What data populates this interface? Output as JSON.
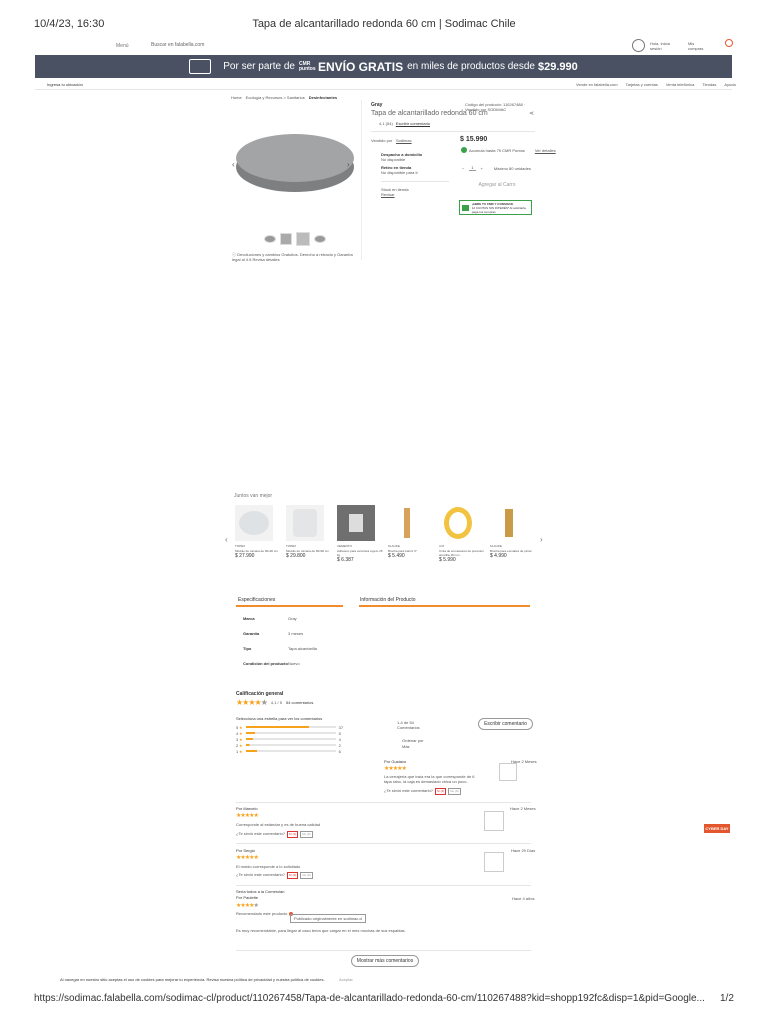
{
  "print_header": {
    "datetime": "10/4/23, 16:30",
    "title": "Tapa de alcantarillado redonda 60 cm | Sodimac Chile"
  },
  "print_footer": {
    "url": "https://sodimac.falabella.com/sodimac-cl/product/110267458/Tapa-de-alcantarillado-redonda-60-cm/110267488?kid=shopp192fc&disp=1&pid=Google...",
    "page": "1/2"
  },
  "top_nav": {
    "menu": "Menú",
    "search_placeholder": "Buscar en falabella.com",
    "account": "Hola, Inicia sesión",
    "orders": "Mis compras"
  },
  "banner": {
    "prefix": "Por ser parte de",
    "cmr": "CMR puntos",
    "highlight": "ENVÍO GRATIS",
    "suffix": "en miles de productos desde",
    "price": "$29.990"
  },
  "subnav": {
    "location": "Ingresa tu ubicación",
    "links": [
      "Vende en falabella.com",
      "Tarjetas y cuentas",
      "Venta telefónica",
      "Tiendas",
      "Ayuda"
    ]
  },
  "breadcrumb": [
    "Home",
    "Ecología y Recursos > Sanitarios",
    "Desinfectantes"
  ],
  "product": {
    "brand": "Gray",
    "name": "Tapa de alcantarillado redonda 60 cm",
    "code": "Código del producto: 110267488 · Vendido por SODIMAC",
    "rating_text": "4,1 (54)",
    "write_review": "Escribir comentario",
    "seller_label": "Vendido por",
    "seller": "Sodimac",
    "price": "$ 15.990",
    "cmr_text": "Acumula hasta 79 CMR Puntos",
    "cmr_link": "Ver detalles",
    "quantity": "1",
    "max_units": "Máximo 80 unidades",
    "add_cart": "Agregar al Carro",
    "delivery_title": "Despacho a domicilio",
    "delivery_status": "No disponible",
    "pickup_title": "Retiro en tienda",
    "pickup_status": "No disponible para ti",
    "stock_title": "Stock en tienda",
    "stock_link": "Revisar",
    "cmr_promo_title": "¡ABRE TU CMR Y CONSIGUE",
    "cmr_promo_sub": "12 CUOTAS SIN INTERÉS* Al solicitarla, paga tus compras",
    "note": "Devoluciones y cambios Gratuitos. Derecho a retracto y Garantía legal al 4.5 Revisa detalles"
  },
  "recommendations": {
    "title": "Juntos van mejor",
    "items": [
      {
        "brand": "TOPEX",
        "name": "Módulo de cámara de 60x30 cm",
        "price": "$ 27.990"
      },
      {
        "brand": "TOPEX",
        "name": "Módulo de cámara de 60x60 cm",
        "price": "$ 29.800"
      },
      {
        "brand": "CEMENTO",
        "name": "Adhesivo para cerámica Ligero 25 kg",
        "price": "$ 6.387"
      },
      {
        "brand": "KLAUKE",
        "name": "Brocha para barniz 3\"",
        "price": "$ 5.490"
      },
      {
        "brand": "3 M",
        "name": "Cinta de enmascarar de precisión amarilla 18 mm",
        "price": "$ 5.990"
      },
      {
        "brand": "KLAUKE",
        "name": "Brocha para esmaltes de pintar",
        "price": "$ 4.990"
      }
    ]
  },
  "specs": {
    "tab_specs": "Especificaciones",
    "tab_info": "Información del Producto",
    "rows": [
      {
        "label": "Marca",
        "value": "Gray"
      },
      {
        "label": "Garantía",
        "value": "3 meses"
      },
      {
        "label": "Tipo",
        "value": "Tapa alcantarilla"
      },
      {
        "label": "Condición del producto",
        "value": "Nuevo"
      }
    ]
  },
  "reviews": {
    "title": "Calificación general",
    "score": "4,1 / 5",
    "count": "54 comentarios",
    "filter_label": "Selecciona una estrella para ver los comentarios",
    "bars": [
      {
        "label": "5",
        "count": "37",
        "pct": 70
      },
      {
        "label": "4",
        "count": "5",
        "pct": 10
      },
      {
        "label": "3",
        "count": "4",
        "pct": 8
      },
      {
        "label": "2",
        "count": "2",
        "pct": 4
      },
      {
        "label": "1",
        "count": "6",
        "pct": 12
      }
    ],
    "count_short": "1-4 de 54 Comentarios",
    "write": "Escribir comentario",
    "sort_label": "Ordenar por",
    "sort_value": "Más",
    "helpful": "¿Te sirvió este comentario?",
    "yes": "Sí (2)",
    "no": "No (0)",
    "items": [
      {
        "author": "Por Gustavo",
        "date": "Hace 2 Meses",
        "text": "La cerrajería que traía era la que corresponde de 6 tapa rabo, la caja es demasiado chica un poco."
      },
      {
        "author": "Por Marcelo",
        "date": "Hace 2 Meses",
        "text": "Corresponde al estándar y es de buena calidad"
      },
      {
        "author": "Por Sergio",
        "date": "Hace 29 Días",
        "text": "El moldo corresponde a lo solicitado"
      },
      {
        "author": "Por Paulette",
        "date": "Hace 4 años",
        "text": "Recomendado este producto",
        "badge": "Publicado originalmente en sodimac.cl"
      }
    ],
    "more": "Mostrar más comentarios",
    "extra_note": "Es muy recomendable, para llegar al caso tenía que cargar en el mes muchas de sus espaldas.",
    "extra_title": "Sería todos a la Comercian"
  },
  "cookie": {
    "text": "Al navegar en nuestro sitio aceptas el uso de cookies para mejorar tu experiencia. Revisa nuestra política de privacidad y nuestra política de cookies.",
    "accept": "Aceptar"
  },
  "floating": {
    "label": "CYBER DAY"
  },
  "colors": {
    "banner_bg": "#495162",
    "accent": "#f28b30",
    "star": "#f7a21b",
    "cmr_green": "#3aa14a"
  }
}
